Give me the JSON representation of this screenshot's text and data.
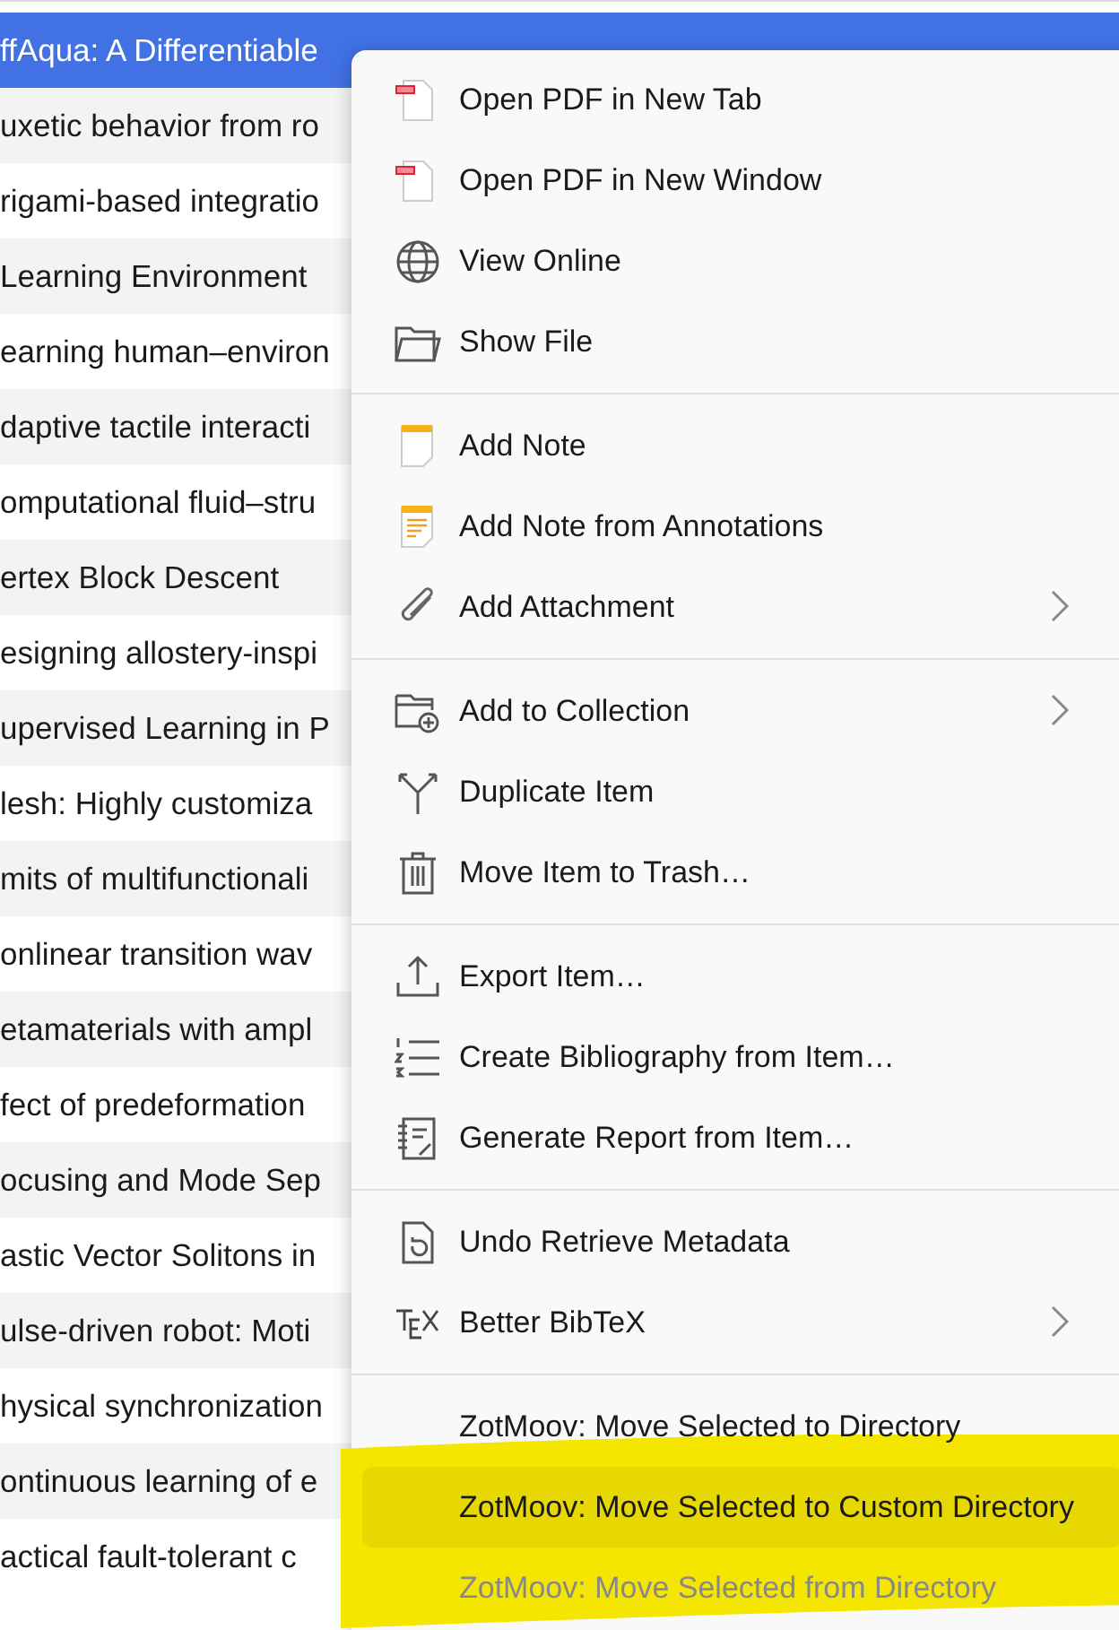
{
  "items_list": {
    "rows": [
      {
        "title": "ffAqua: A Differentiable",
        "selected": true
      },
      {
        "title": "uxetic behavior from ro",
        "selected": false
      },
      {
        "title": "rigami-based integratio",
        "selected": false
      },
      {
        "title": "Learning Environment",
        "selected": false
      },
      {
        "title": "earning human–environ",
        "selected": false
      },
      {
        "title": "daptive tactile interacti",
        "selected": false
      },
      {
        "title": "omputational fluid–stru",
        "selected": false
      },
      {
        "title": "ertex Block Descent",
        "selected": false
      },
      {
        "title": "esigning allostery-inspi",
        "selected": false
      },
      {
        "title": "upervised Learning in P",
        "selected": false
      },
      {
        "title": "lesh: Highly customiza",
        "selected": false
      },
      {
        "title": "mits of multifunctionali",
        "selected": false
      },
      {
        "title": "onlinear transition wav",
        "selected": false
      },
      {
        "title": "etamaterials with ampl",
        "selected": false
      },
      {
        "title": "fect of predeformation",
        "selected": false
      },
      {
        "title": "ocusing and Mode Sep",
        "selected": false
      },
      {
        "title": "astic Vector Solitons in",
        "selected": false
      },
      {
        "title": "ulse-driven robot: Moti",
        "selected": false
      },
      {
        "title": "hysical synchronization",
        "selected": false
      },
      {
        "title": "ontinuous learning of e",
        "selected": false
      },
      {
        "title": "actical fault-tolerant c",
        "selected": false
      }
    ]
  },
  "context_menu": {
    "sections": [
      [
        {
          "label": "Open PDF in New Tab",
          "submenu": false,
          "disabled": false,
          "hovered": false
        },
        {
          "label": "Open PDF in New Window",
          "submenu": false,
          "disabled": false,
          "hovered": false
        },
        {
          "label": "View Online",
          "submenu": false,
          "disabled": false,
          "hovered": false
        },
        {
          "label": "Show File",
          "submenu": false,
          "disabled": false,
          "hovered": false
        }
      ],
      [
        {
          "label": "Add Note",
          "submenu": false,
          "disabled": false,
          "hovered": false
        },
        {
          "label": "Add Note from Annotations",
          "submenu": false,
          "disabled": false,
          "hovered": false
        },
        {
          "label": "Add Attachment",
          "submenu": true,
          "disabled": false,
          "hovered": false
        }
      ],
      [
        {
          "label": "Add to Collection",
          "submenu": true,
          "disabled": false,
          "hovered": false
        },
        {
          "label": "Duplicate Item",
          "submenu": false,
          "disabled": false,
          "hovered": false
        },
        {
          "label": "Move Item to Trash…",
          "submenu": false,
          "disabled": false,
          "hovered": false
        }
      ],
      [
        {
          "label": "Export Item…",
          "submenu": false,
          "disabled": false,
          "hovered": false
        },
        {
          "label": "Create Bibliography from Item…",
          "submenu": false,
          "disabled": false,
          "hovered": false
        },
        {
          "label": "Generate Report from Item…",
          "submenu": false,
          "disabled": false,
          "hovered": false
        }
      ],
      [
        {
          "label": "Undo Retrieve Metadata",
          "submenu": false,
          "disabled": false,
          "hovered": false
        },
        {
          "label": "Better BibTeX",
          "submenu": true,
          "disabled": false,
          "hovered": false
        }
      ],
      [
        {
          "label": "ZotMoov: Move Selected to Directory",
          "submenu": false,
          "disabled": false,
          "hovered": false
        },
        {
          "label": "ZotMoov: Move Selected to Custom Directory",
          "submenu": false,
          "disabled": false,
          "hovered": true
        },
        {
          "label": "ZotMoov: Move Selected from Directory",
          "submenu": false,
          "disabled": true,
          "hovered": false
        }
      ]
    ]
  },
  "highlighter": {
    "color": "#f5e600"
  }
}
